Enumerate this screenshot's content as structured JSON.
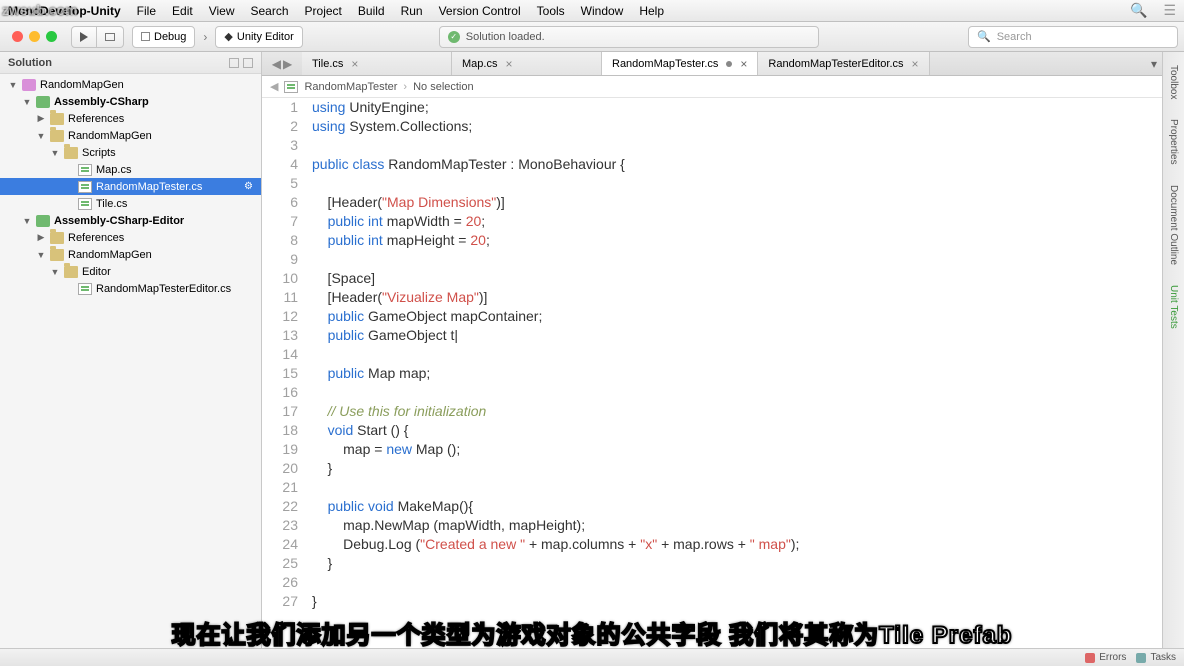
{
  "menubar": {
    "title": "MonoDevelop-Unity",
    "items": [
      "File",
      "Edit",
      "View",
      "Search",
      "Project",
      "Build",
      "Run",
      "Version Control",
      "Tools",
      "Window",
      "Help"
    ]
  },
  "toolbar": {
    "config": "Debug",
    "target": "Unity Editor",
    "status": "Solution loaded.",
    "search_placeholder": "Search"
  },
  "solution": {
    "title": "Solution",
    "tree": [
      {
        "d": 0,
        "kind": "sln",
        "label": "RandomMapGen",
        "open": true
      },
      {
        "d": 1,
        "kind": "proj",
        "label": "Assembly-CSharp",
        "open": true,
        "bold": true
      },
      {
        "d": 2,
        "kind": "folder",
        "label": "References",
        "open": false
      },
      {
        "d": 2,
        "kind": "folder",
        "label": "RandomMapGen",
        "open": true
      },
      {
        "d": 3,
        "kind": "folder",
        "label": "Scripts",
        "open": true
      },
      {
        "d": 4,
        "kind": "cs",
        "label": "Map.cs"
      },
      {
        "d": 4,
        "kind": "cs",
        "label": "RandomMapTester.cs",
        "selected": true,
        "cog": true
      },
      {
        "d": 4,
        "kind": "cs",
        "label": "Tile.cs"
      },
      {
        "d": 1,
        "kind": "proj",
        "label": "Assembly-CSharp-Editor",
        "open": true,
        "bold": true
      },
      {
        "d": 2,
        "kind": "folder",
        "label": "References",
        "open": false
      },
      {
        "d": 2,
        "kind": "folder",
        "label": "RandomMapGen",
        "open": true
      },
      {
        "d": 3,
        "kind": "folder",
        "label": "Editor",
        "open": true
      },
      {
        "d": 4,
        "kind": "cs",
        "label": "RandomMapTesterEditor.cs"
      }
    ]
  },
  "tabs": [
    {
      "label": "Tile.cs",
      "active": false,
      "dirty": false
    },
    {
      "label": "Map.cs",
      "active": false,
      "dirty": false
    },
    {
      "label": "RandomMapTester.cs",
      "active": true,
      "dirty": true
    },
    {
      "label": "RandomMapTesterEditor.cs",
      "active": false,
      "dirty": false
    }
  ],
  "breadcrumb": {
    "file": "RandomMapTester",
    "sel": "No selection"
  },
  "code_lines": [
    {
      "n": 1,
      "t": [
        [
          "kw",
          "using"
        ],
        [
          "pl",
          " UnityEngine;"
        ]
      ]
    },
    {
      "n": 2,
      "t": [
        [
          "kw",
          "using"
        ],
        [
          "pl",
          " System.Collections;"
        ]
      ]
    },
    {
      "n": 3,
      "t": []
    },
    {
      "n": 4,
      "t": [
        [
          "kw",
          "public class"
        ],
        [
          "pl",
          " RandomMapTester : MonoBehaviour {"
        ]
      ]
    },
    {
      "n": 5,
      "t": []
    },
    {
      "n": 6,
      "t": [
        [
          "pl",
          "    [Header("
        ],
        [
          "str",
          "\"Map Dimensions\""
        ],
        [
          "pl",
          ")]"
        ]
      ]
    },
    {
      "n": 7,
      "t": [
        [
          "pl",
          "    "
        ],
        [
          "kw",
          "public int"
        ],
        [
          "pl",
          " mapWidth = "
        ],
        [
          "num",
          "20"
        ],
        [
          "pl",
          ";"
        ]
      ]
    },
    {
      "n": 8,
      "t": [
        [
          "pl",
          "    "
        ],
        [
          "kw",
          "public int"
        ],
        [
          "pl",
          " mapHeight = "
        ],
        [
          "num",
          "20"
        ],
        [
          "pl",
          ";"
        ]
      ]
    },
    {
      "n": 9,
      "t": []
    },
    {
      "n": 10,
      "t": [
        [
          "pl",
          "    [Space]"
        ]
      ]
    },
    {
      "n": 11,
      "t": [
        [
          "pl",
          "    [Header("
        ],
        [
          "str",
          "\"Vizualize Map\""
        ],
        [
          "pl",
          ")]"
        ]
      ]
    },
    {
      "n": 12,
      "t": [
        [
          "pl",
          "    "
        ],
        [
          "kw",
          "public"
        ],
        [
          "pl",
          " GameObject mapContainer;"
        ]
      ]
    },
    {
      "n": 13,
      "t": [
        [
          "pl",
          "    "
        ],
        [
          "kw",
          "public"
        ],
        [
          "pl",
          " GameObject t|"
        ]
      ]
    },
    {
      "n": 14,
      "t": []
    },
    {
      "n": 15,
      "t": [
        [
          "pl",
          "    "
        ],
        [
          "kw",
          "public"
        ],
        [
          "pl",
          " Map map;"
        ]
      ]
    },
    {
      "n": 16,
      "t": []
    },
    {
      "n": 17,
      "t": [
        [
          "pl",
          "    "
        ],
        [
          "cmt",
          "// Use this for initialization"
        ]
      ]
    },
    {
      "n": 18,
      "t": [
        [
          "pl",
          "    "
        ],
        [
          "kw",
          "void"
        ],
        [
          "pl",
          " Start () {"
        ]
      ]
    },
    {
      "n": 19,
      "t": [
        [
          "pl",
          "        map = "
        ],
        [
          "kw",
          "new"
        ],
        [
          "pl",
          " Map ();"
        ]
      ]
    },
    {
      "n": 20,
      "t": [
        [
          "pl",
          "    }"
        ]
      ]
    },
    {
      "n": 21,
      "t": []
    },
    {
      "n": 22,
      "t": [
        [
          "pl",
          "    "
        ],
        [
          "kw",
          "public void"
        ],
        [
          "pl",
          " MakeMap(){"
        ]
      ]
    },
    {
      "n": 23,
      "t": [
        [
          "pl",
          "        map.NewMap (mapWidth, mapHeight);"
        ]
      ]
    },
    {
      "n": 24,
      "t": [
        [
          "pl",
          "        Debug.Log ("
        ],
        [
          "str",
          "\"Created a new \""
        ],
        [
          "pl",
          " + map.columns + "
        ],
        [
          "str",
          "\"x\""
        ],
        [
          "pl",
          " + map.rows + "
        ],
        [
          "str",
          "\" map\""
        ],
        [
          "pl",
          ");"
        ]
      ]
    },
    {
      "n": 25,
      "t": [
        [
          "pl",
          "    }"
        ]
      ]
    },
    {
      "n": 26,
      "t": []
    },
    {
      "n": 27,
      "t": [
        [
          "pl",
          "}"
        ]
      ]
    }
  ],
  "right_dock": [
    "Toolbox",
    "Properties",
    "Document Outline",
    "Unit Tests"
  ],
  "statusbar": {
    "errors": "Errors",
    "tasks": "Tasks"
  },
  "subtitle": "现在让我们添加另一个类型为游戏对象的公共字段 我们将其称为Tile Prefab",
  "watermark": "zwsub.com"
}
